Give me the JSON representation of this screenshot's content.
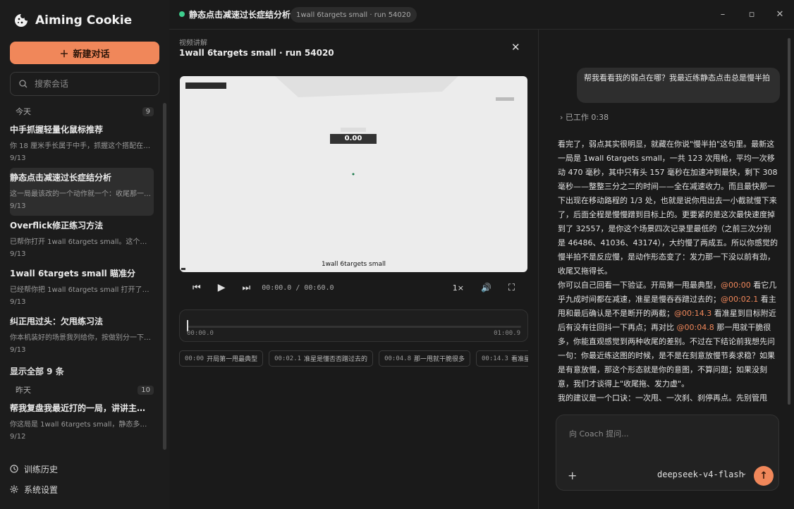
{
  "app": {
    "name": "Aiming Cookie"
  },
  "sidebar": {
    "new_chat_label": "新建对话",
    "search_placeholder": "搜索会话",
    "groups": [
      {
        "label": "今天",
        "count": "9",
        "items": [
          {
            "title": "中手抓握轻量化鼠标推荐",
            "preview": "你 18 厘米手长属于中手，抓握这个搭配在鼠...",
            "date": "9/13"
          },
          {
            "title": "静态点击减速过长症结分析",
            "preview": "这一局最该改的一个动作就一个：收尾那一下...",
            "date": "9/13"
          },
          {
            "title": "Overflick修正练习方法",
            "preview": "已帮你打开 1wall 6targets small。这个就是...",
            "date": "9/13"
          },
          {
            "title": "1wall 6targets small 瞄准分",
            "preview": "已经帮你把 1wall 6targets small 打开了，Ko...",
            "date": "9/13"
          },
          {
            "title": "纠正甩过头：欠甩练习法",
            "preview": "你本机装好的场景我列给你，按做别分一下一...",
            "date": "9/13"
          }
        ],
        "show_all": "显示全部 9 条"
      },
      {
        "label": "昨天",
        "count": "10",
        "items": [
          {
            "title": "帮我复盘我最近打的一局，讲讲主要...",
            "preview": "你这局是 1wall 6targets small，静态多点甩...",
            "date": "9/12"
          }
        ]
      }
    ],
    "footer": {
      "history": "训练历史",
      "settings": "系统设置"
    }
  },
  "header": {
    "title": "静态点击减速过长症结分析",
    "chip": "1wall 6targets small · run 54020"
  },
  "video_panel": {
    "kicker": "视频讲解",
    "title": "1wall 6targets small · run 54020",
    "overlay_score": "0.00",
    "overlay_caption": "1wall 6targets small",
    "time": "00:00.0 / 00:60.0",
    "speed": "1×",
    "timeline_start": "00:00.0",
    "timeline_end": "01:00.9",
    "chapters": [
      {
        "time": "00:00",
        "label": "开局第一甩最典型"
      },
      {
        "time": "00:02.1",
        "label": "准星是懂否否蹭过去的"
      },
      {
        "time": "00:04.8",
        "label": "那一甩就干脆很多"
      },
      {
        "time": "00:14.3",
        "label": "看准星到目标"
      }
    ]
  },
  "chat": {
    "user_message": "帮我看看我的弱点在哪？我最近练静态点击总是慢半拍",
    "worked_label": "已工作 0:38",
    "answer": {
      "p1": "看完了，弱点其实很明显，就藏在你说\"慢半拍\"这句里。最新这一局是 1wall 6targets small，一共 123 次甩枪，平均一次移动 470 毫秒，其中只有头 157 毫秒在加速冲到最快，剩下 308 毫秒——整整三分之二的时间——全在减速收力。而且最快那一下出现在移动路程的 1/3 处，也就是说你甩出去一小截就慢下来了，后面全程是慢慢蹭到目标上的。更要紧的是这次最快速度掉到了 32557，是你这个场景四次记录里最低的（之前三次分别是 46486、41036、43174），大约慢了两成五。所以你感觉的慢半拍不是反应慢，是动作形态变了：发力那一下没以前有劲，收尾又拖得长。",
      "p2_a": "你可以自己回看一下验证。开局第一甩最典型，",
      "ts1": "@00:00",
      "p2_b": " 看它几乎九成时间都在减速，准星是慢吞吞蹭过去的；",
      "ts2": "@00:02.1",
      "p2_c": " 看主甩和最后确认是不是断开的两截；",
      "ts3": "@00:14.3",
      "p2_d": " 看准星到目标附近后有没有往回抖一下再点；再对比 ",
      "ts4": "@00:04.8",
      "p2_e": " 那一甩就干脆很多，你能直观感觉到两种收尾的差别。不过在下结论前我想先问一句：你最近练这图的时候，是不是在刻意放慢节奏求稳？如果是有意放慢，那这个形态就是你的意图，不算问题；如果没刻意，我们才谈得上\"收尾拖、发力虚\"。",
      "p3": "我的建议是一个口诀：一次甩、一次刹、刹停再点。先别管甩"
    },
    "input_placeholder": "向 Coach 提问...",
    "model": "deepseek-v4-flash"
  },
  "colors": {
    "accent": "#f0875a",
    "status": "#3ecf8e"
  }
}
